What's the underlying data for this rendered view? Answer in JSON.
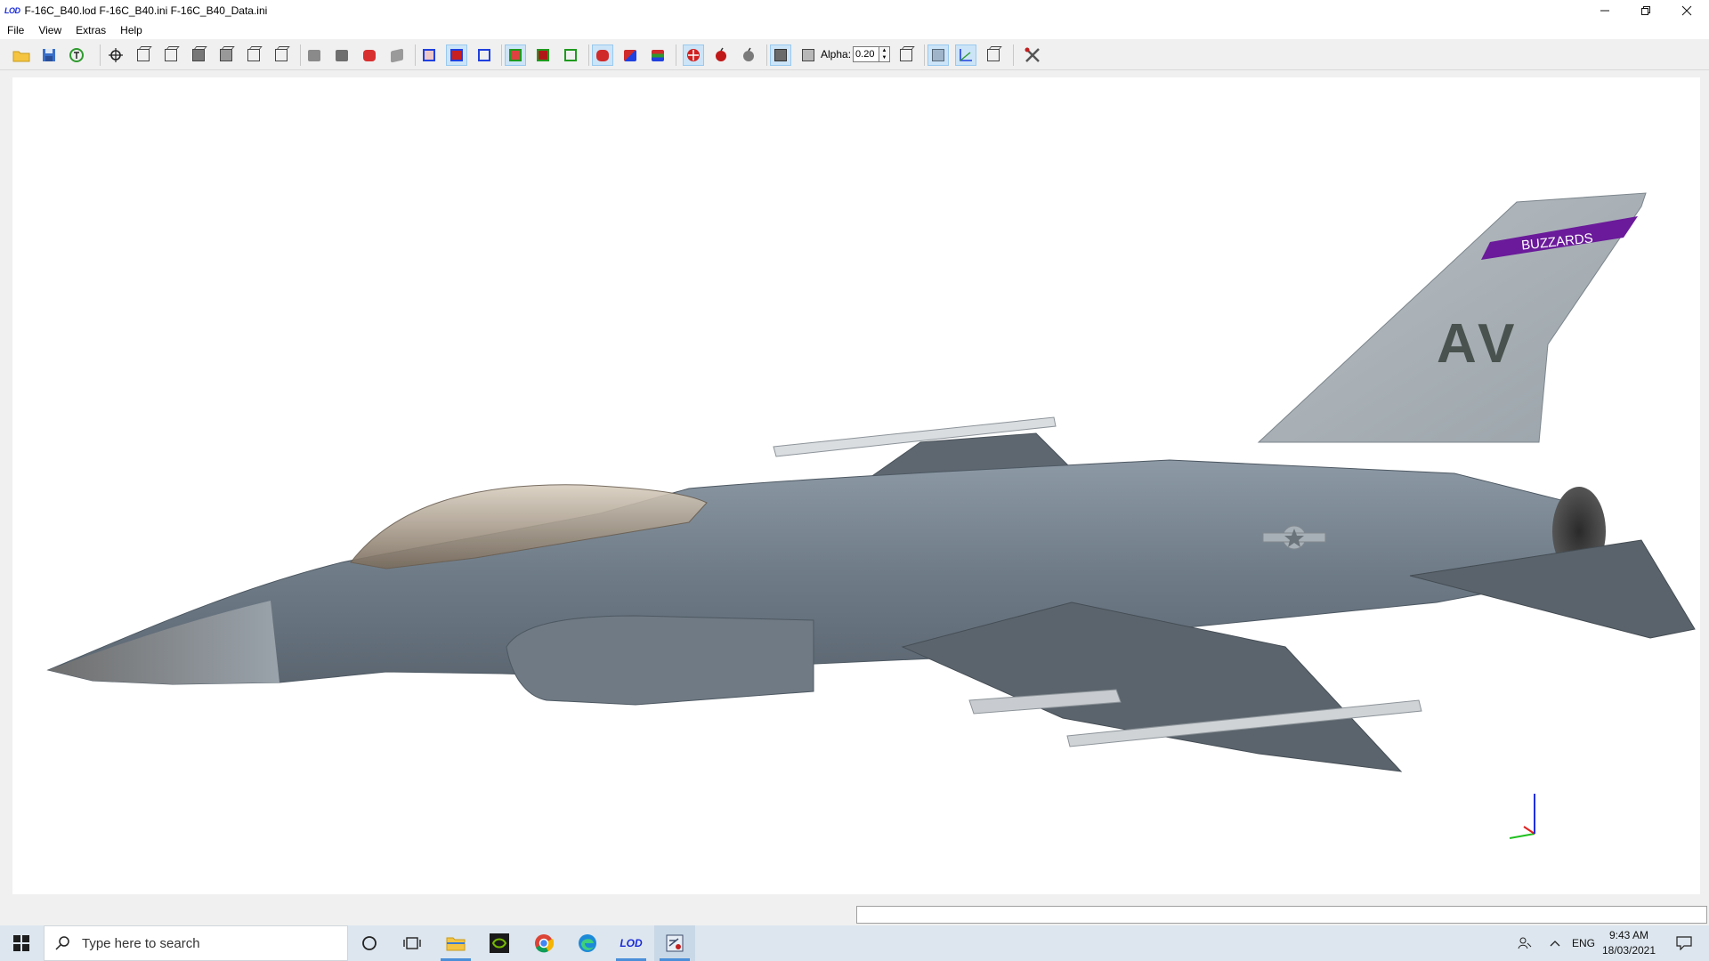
{
  "window": {
    "app_logo": "LOD",
    "title": "F-16C_B40.lod  F-16C_B40.ini  F-16C_B40_Data.ini",
    "controls": [
      "minimize",
      "restore",
      "close"
    ]
  },
  "menu": {
    "items": [
      "File",
      "View",
      "Extras",
      "Help"
    ]
  },
  "toolbar": {
    "alpha_label": "Alpha:",
    "alpha_value": "0.20",
    "icons": [
      "open-folder-icon",
      "save-icon",
      "reload-icon",
      "zoom-icon",
      "view-front-icon",
      "view-back-icon",
      "view-top-icon",
      "view-bottom-icon",
      "view-left-icon",
      "view-right-icon",
      "shade-flat-icon",
      "shade-solid-icon",
      "shade-red-icon",
      "shade-gray-icon",
      "bounding-box-blue-icon",
      "bounding-box-active-icon",
      "bounding-box-icon",
      "green-box-icon",
      "green-box-filled-icon",
      "green-box-outline-icon",
      "red-mesh-icon",
      "color-mesh-icon",
      "layered-mesh-icon",
      "hit-point-icon",
      "bomb-red-icon",
      "bomb-gray-icon",
      "cube-solid-icon",
      "cube-wire-icon",
      "cube-alpha-icon",
      "texture-icon",
      "axes-icon",
      "box-outline-icon",
      "tools-icon"
    ]
  },
  "viewport": {
    "model": "F-16C aircraft",
    "tail_band_text": "BUZZARDS",
    "tail_code": "AV",
    "axis_colors": {
      "x": "#e02020",
      "y": "#20c020",
      "z": "#2030e0"
    }
  },
  "taskbar": {
    "search_placeholder": "Type here to search",
    "apps": [
      "cortana-icon",
      "task-view-icon",
      "file-explorer-icon",
      "nvidia-icon",
      "chrome-icon",
      "edge-icon",
      "lod-app-icon",
      "lod-editor-icon"
    ],
    "language": "ENG",
    "time": "9:43 AM",
    "date": "18/03/2021"
  }
}
